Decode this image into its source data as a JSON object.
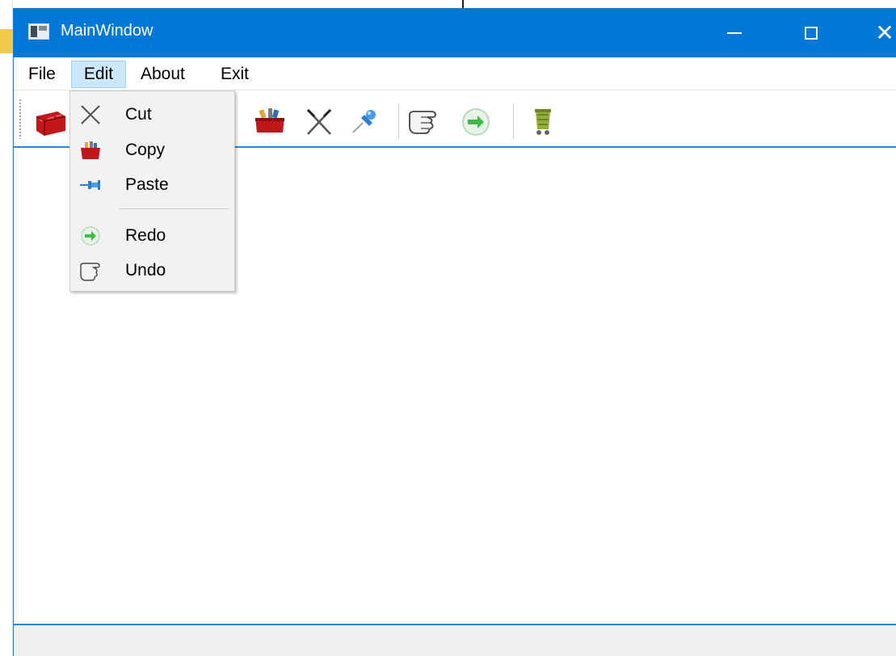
{
  "window": {
    "title": "MainWindow"
  },
  "menubar": {
    "items": [
      {
        "label": "File"
      },
      {
        "label": "Edit",
        "state": "open"
      },
      {
        "label": "About"
      },
      {
        "label": "Exit"
      }
    ]
  },
  "edit_menu": {
    "items": [
      {
        "label": "Cut",
        "icon": "scissors-icon"
      },
      {
        "label": "Copy",
        "icon": "toolbox-icon"
      },
      {
        "label": "Paste",
        "icon": "pin-icon"
      },
      {
        "label": "Redo",
        "icon": "green-arrow-icon"
      },
      {
        "label": "Undo",
        "icon": "pointing-hand-icon"
      }
    ]
  },
  "toolbar": {
    "buttons": [
      {
        "icon": "red-basket-icon"
      },
      {
        "icon": "toolbox-icon"
      },
      {
        "icon": "scissors-icon"
      },
      {
        "icon": "pin-icon"
      },
      {
        "icon": "pointing-hand-icon"
      },
      {
        "icon": "green-arrow-icon"
      },
      {
        "icon": "trash-cart-icon"
      }
    ]
  },
  "colors": {
    "titlebar": "#0078d7",
    "menu_highlight": "#cce8ff",
    "central_border": "#2b88d8"
  }
}
